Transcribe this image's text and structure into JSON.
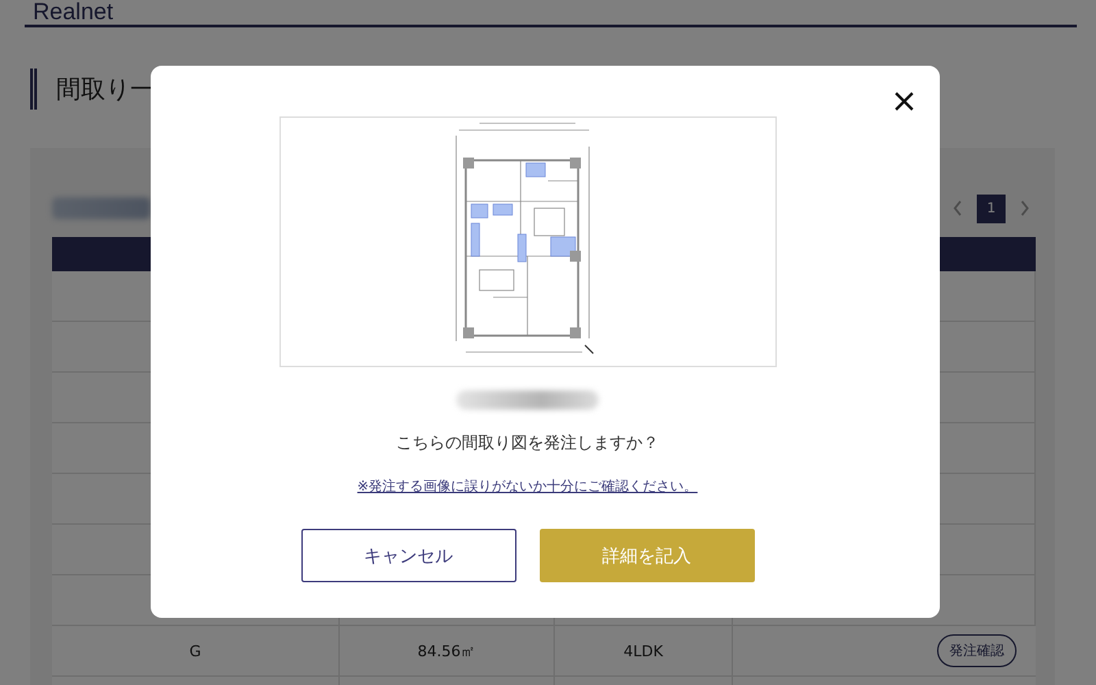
{
  "header": {
    "logo": "Realnet"
  },
  "page_heading": "間取り一",
  "pagination": {
    "pages": [
      {
        "label": "1",
        "selected": true
      }
    ]
  },
  "table": {
    "rows": [
      {
        "cells": [
          "G",
          "84.56㎡",
          "4LDK"
        ],
        "action": "発注確認"
      }
    ]
  },
  "modal": {
    "question": "こちらの間取り図を発注しますか？",
    "note_link": "※発注する画像に誤りがないか十分にご確認ください。",
    "buttons": [
      {
        "label": "キャンセル",
        "kind": "secondary"
      },
      {
        "label": "詳細を記入",
        "kind": "primary"
      }
    ]
  }
}
